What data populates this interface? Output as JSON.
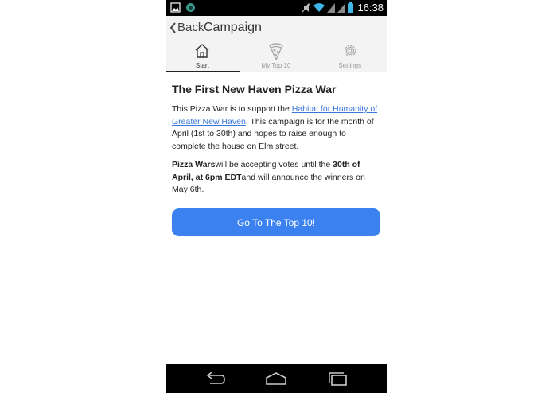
{
  "status_bar": {
    "time": "16:38"
  },
  "header": {
    "back_label": "Back",
    "title": "Campaign",
    "tabs": [
      {
        "label": "Start",
        "icon": "home-icon",
        "active": true
      },
      {
        "label": "My Top 10",
        "icon": "pizza-icon",
        "active": false
      },
      {
        "label": "Settings",
        "icon": "gear-icon",
        "active": false
      }
    ]
  },
  "main": {
    "heading": "The First New Haven Pizza War",
    "para1": {
      "before": "This Pizza War is to support the ",
      "link": "Habitat for Humanity of Greater New Haven",
      "after": ". This campaign is for the month of April (1st to 30th) and hopes to raise enough to complete the house on Elm street."
    },
    "para2": {
      "bold1": "Pizza Wars",
      "mid1": "will be accepting votes until the ",
      "bold2": "30th of April, at 6pm EDT",
      "end": "and will announce the winners on May 6th."
    },
    "cta_label": "Go To The Top 10!"
  },
  "colors": {
    "accent": "#3b82f0",
    "link": "#3a78d8",
    "header_bg": "#f3f3f3"
  }
}
